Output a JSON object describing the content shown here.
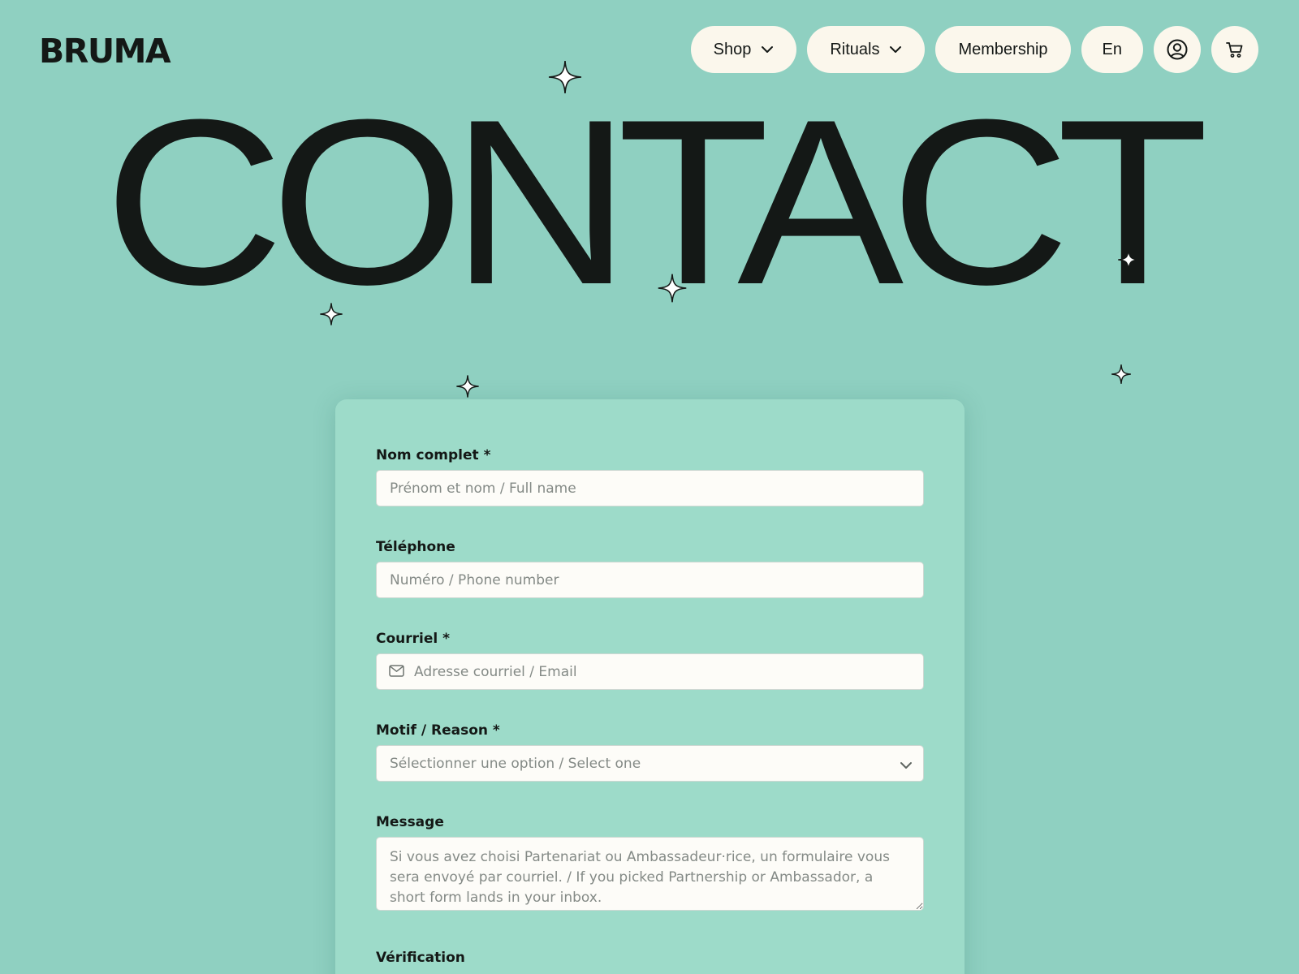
{
  "brand": {
    "logo": "BRUMA"
  },
  "nav": {
    "shop": "Shop",
    "rituals": "Rituals",
    "membership": "Membership",
    "language": "En",
    "account_icon": "user-circle-icon",
    "cart_icon": "cart-icon"
  },
  "hero": {
    "title": "CONTACT"
  },
  "form": {
    "full_name": {
      "label": "Nom complet *",
      "placeholder": "Prénom et nom / Full name"
    },
    "phone": {
      "label": "Téléphone",
      "placeholder": "Numéro / Phone number"
    },
    "email": {
      "label": "Courriel *",
      "placeholder": "Adresse courriel / Email",
      "icon": "mail-icon"
    },
    "reason": {
      "label": "Motif / Reason *",
      "placeholder": "Sélectionner une option / Select one"
    },
    "message": {
      "label": "Message",
      "placeholder": "Si vous avez choisi Partenariat ou Ambassadeur·rice, un formulaire vous sera envoyé par courriel. / If you picked Partnership or Ambassador, a short form lands in your inbox."
    },
    "verification": {
      "label": "Vérification"
    }
  },
  "colors": {
    "background": "#8fd0c1",
    "card": "#9ddbc9",
    "pill": "#fbf7ec",
    "text": "#141816"
  }
}
